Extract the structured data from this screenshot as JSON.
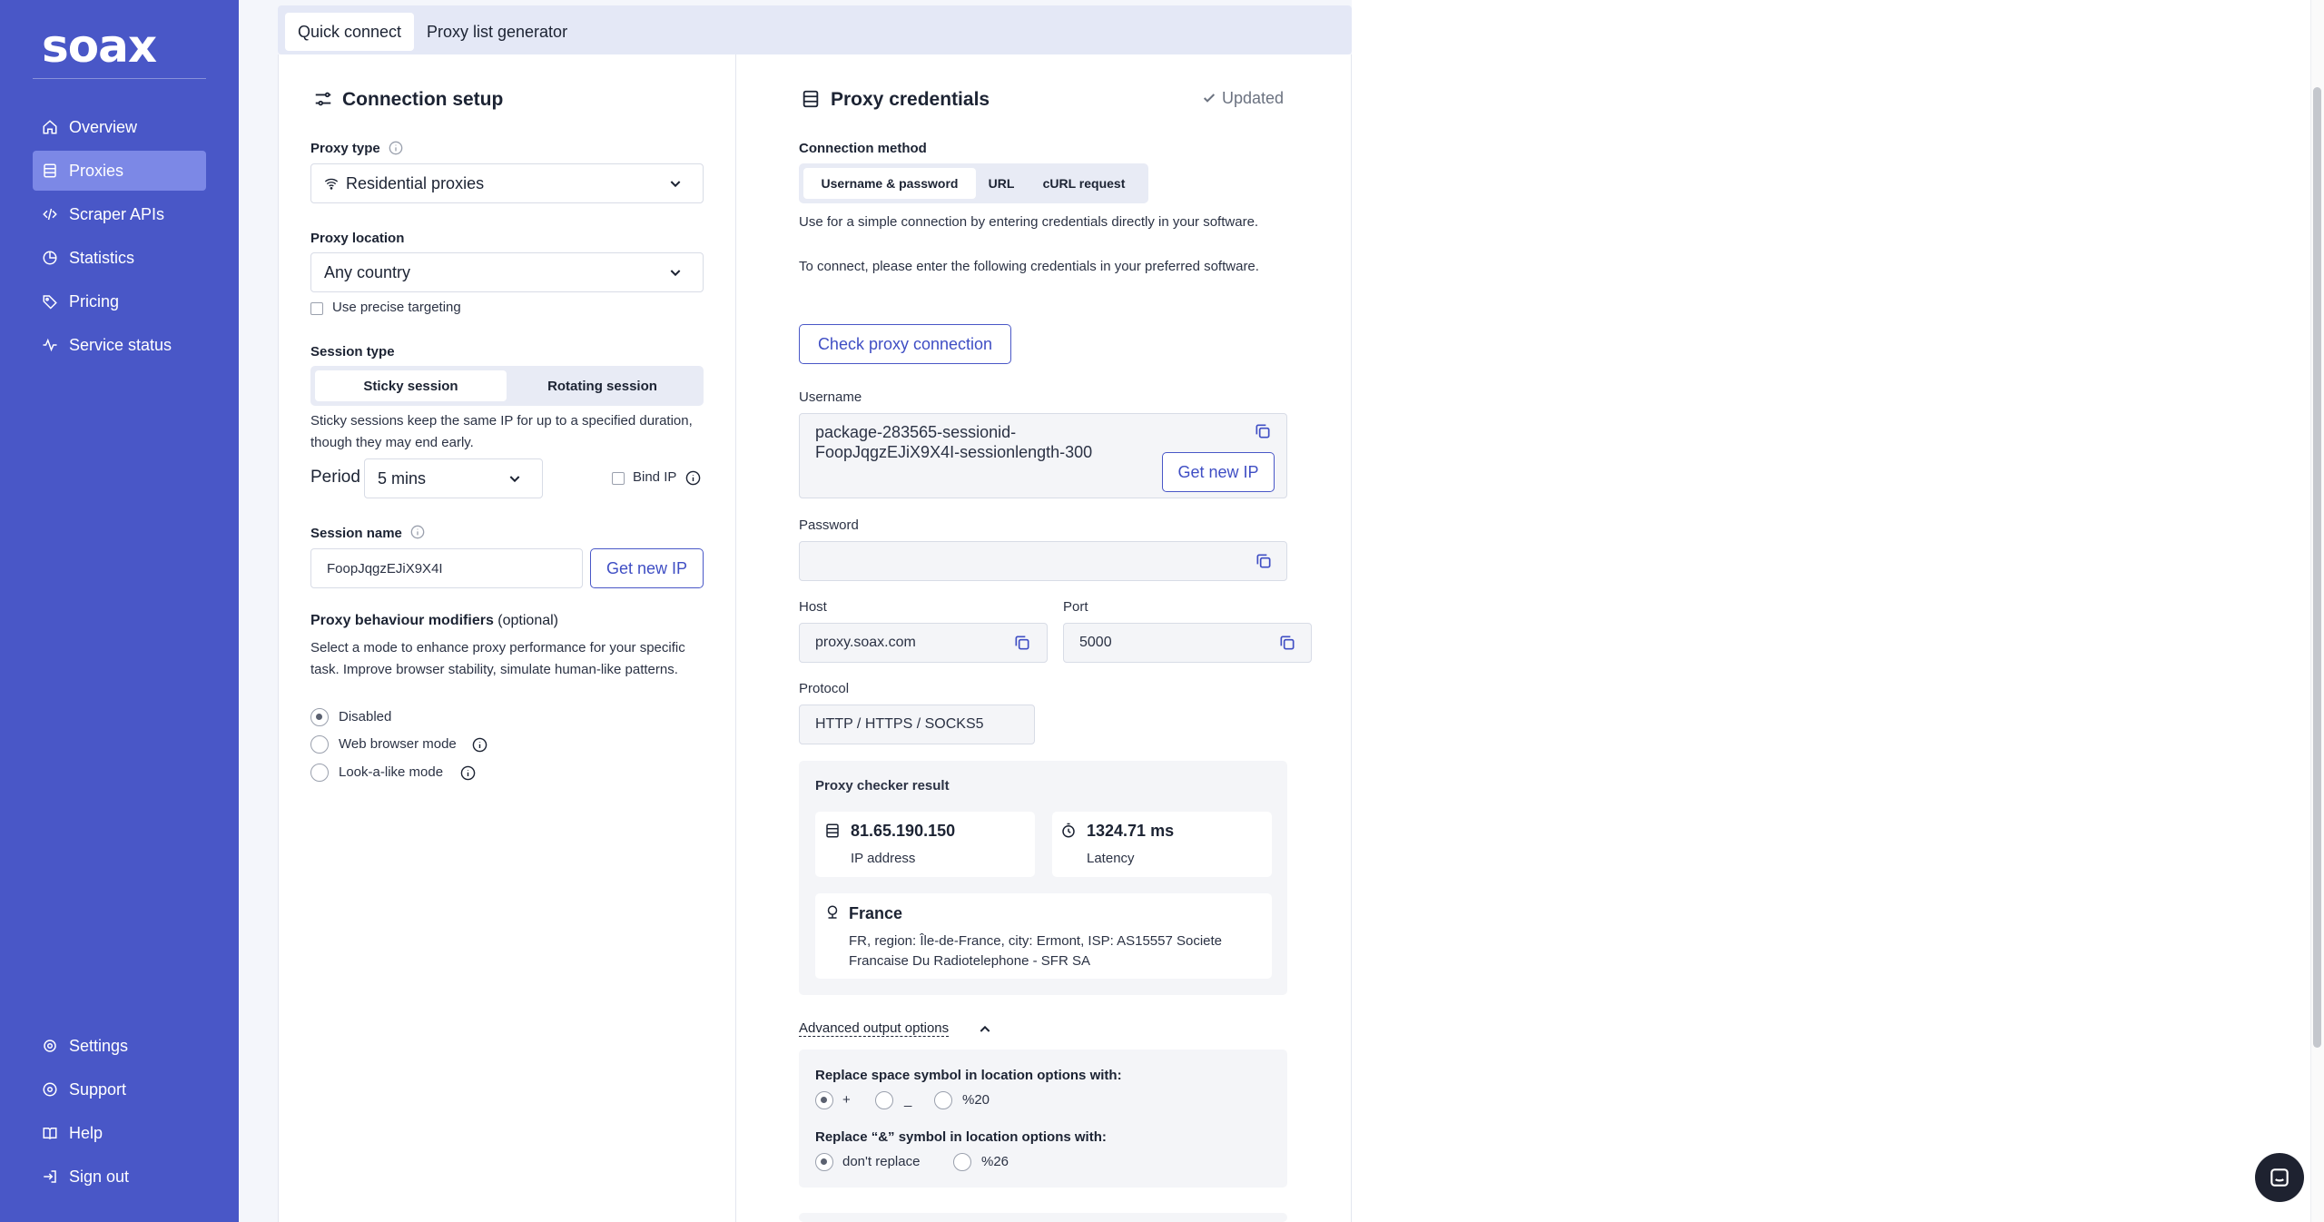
{
  "brand": {
    "logo": "soax"
  },
  "sidebar": {
    "items": [
      {
        "label": "Overview",
        "icon": "home-icon"
      },
      {
        "label": "Proxies",
        "icon": "server-icon",
        "active": true
      },
      {
        "label": "Scraper APIs",
        "icon": "code-icon"
      },
      {
        "label": "Statistics",
        "icon": "pie-chart-icon"
      },
      {
        "label": "Pricing",
        "icon": "tag-icon"
      },
      {
        "label": "Service status",
        "icon": "activity-icon"
      }
    ],
    "bottom_items": [
      {
        "label": "Settings",
        "icon": "gear-icon"
      },
      {
        "label": "Support",
        "icon": "chat-icon"
      },
      {
        "label": "Help",
        "icon": "book-icon"
      },
      {
        "label": "Sign out",
        "icon": "sign-out-icon"
      }
    ]
  },
  "tabs": [
    {
      "label": "Quick connect",
      "active": true
    },
    {
      "label": "Proxy list generator",
      "active": false
    }
  ],
  "connection_setup": {
    "title": "Connection setup",
    "proxy_type": {
      "label": "Proxy type",
      "value": "Residential proxies"
    },
    "proxy_location": {
      "label": "Proxy location",
      "value": "Any country",
      "precise_label": "Use precise targeting",
      "precise_checked": false
    },
    "session_type": {
      "label": "Session type",
      "options": [
        "Sticky session",
        "Rotating session"
      ],
      "selected": "Sticky session",
      "description": "Sticky sessions keep the same IP for up to a specified duration, though they may end early."
    },
    "period": {
      "label": "Period",
      "value": "5 mins"
    },
    "bind_ip": {
      "label": "Bind IP",
      "checked": false
    },
    "session_name": {
      "label": "Session name",
      "value": "FoopJqgzEJiX9X4I",
      "button": "Get new IP"
    },
    "modifiers": {
      "label": "Proxy behaviour modifiers",
      "optional": "(optional)",
      "description": "Select a mode to enhance proxy performance for your specific task. Improve browser stability, simulate human-like patterns.",
      "options": [
        "Disabled",
        "Web browser mode",
        "Look-a-like mode"
      ],
      "selected": "Disabled"
    }
  },
  "credentials": {
    "title": "Proxy credentials",
    "status": "Updated",
    "method": {
      "label": "Connection method",
      "options": [
        "Username & password",
        "URL",
        "cURL request"
      ],
      "selected": "Username & password"
    },
    "description1": "Use for a simple connection by entering credentials directly in your software.",
    "description2": "To connect, please enter the following credentials in your preferred software.",
    "check_button": "Check proxy connection",
    "username": {
      "label": "Username",
      "line1": "package-283565-sessionid-",
      "line2": "FoopJqgzEJiX9X4I-sessionlength-300",
      "button": "Get new IP"
    },
    "password": {
      "label": "Password",
      "value": ""
    },
    "host": {
      "label": "Host",
      "value": "proxy.soax.com"
    },
    "port": {
      "label": "Port",
      "value": "5000"
    },
    "protocol": {
      "label": "Protocol",
      "value": "HTTP / HTTPS / SOCKS5"
    },
    "checker": {
      "title": "Proxy checker result",
      "ip": {
        "value": "81.65.190.150",
        "label": "IP address"
      },
      "latency": {
        "value": "1324.71 ms",
        "label": "Latency"
      },
      "country": "France",
      "details1": "FR, region: Île-de-France, city: Ermont, ISP: AS15557 Societe",
      "details2": "Francaise Du Radiotelephone - SFR SA"
    },
    "advanced": {
      "label": "Advanced output options",
      "space_label": "Replace space symbol in location options with:",
      "space_options": [
        "+",
        "_",
        "%20"
      ],
      "space_selected": "+",
      "amp_label": "Replace “&” symbol in location options with:",
      "amp_options": [
        "don't replace",
        "%26"
      ],
      "amp_selected": "don't replace"
    }
  },
  "colors": {
    "sidebar": "#4957c7",
    "accent": "#3f4ec4",
    "active_nav": "#7c88e6"
  }
}
